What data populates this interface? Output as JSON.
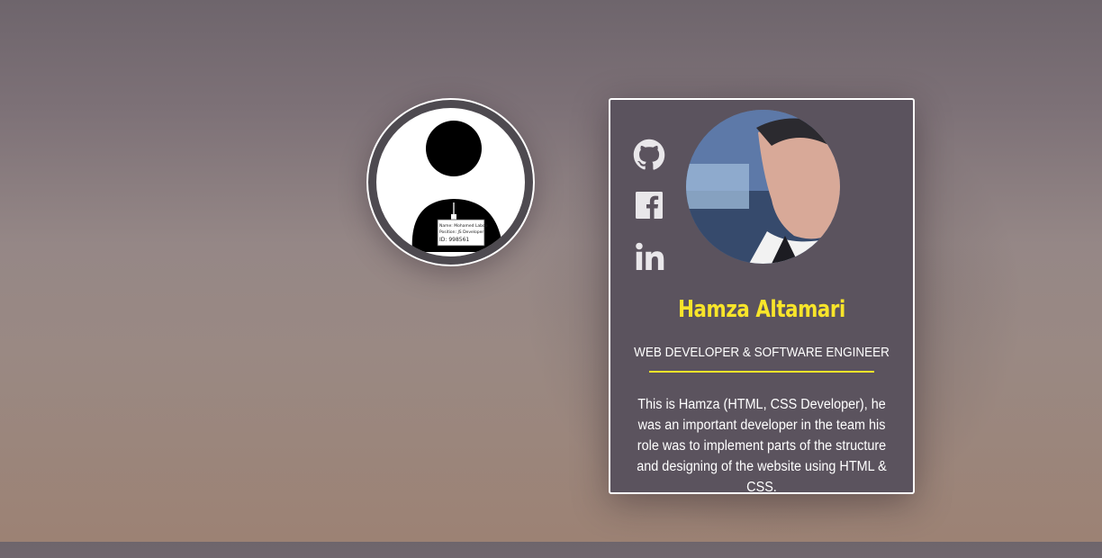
{
  "team_member": {
    "name": "Hamza Altamari",
    "role": "WEB DEVELOPER & SOFTWARE ENGINEER",
    "description": "This is Hamza (HTML, CSS Developer), he was an important developer in the team his role was to implement parts of the structure and designing of the website using HTML & CSS.",
    "social": [
      {
        "icon": "github-icon"
      },
      {
        "icon": "facebook-icon"
      },
      {
        "icon": "linkedin-icon"
      }
    ]
  },
  "badge": {
    "line1": "Name: Mohamed Laboo",
    "line2": "Position: JS Developer",
    "line3": "ID: 998561"
  },
  "colors": {
    "accent": "#f8e52a",
    "card_bg": "#5b535e",
    "icon": "#e9e7ea"
  }
}
